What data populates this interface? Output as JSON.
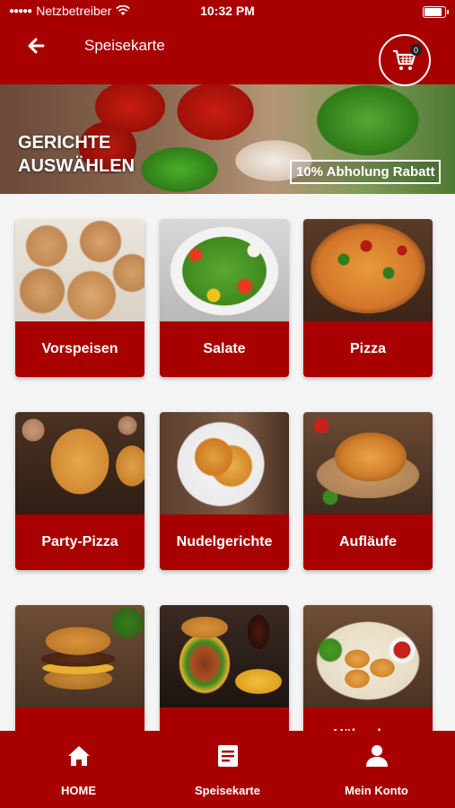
{
  "status_bar": {
    "carrier": "Netzbetreiber",
    "time": "10:32 PM",
    "battery_level": 0.9
  },
  "header": {
    "title": "Speisekarte",
    "cart_count": "0"
  },
  "hero": {
    "title_line1": "GERICHTE",
    "title_line2": "AUSWÄHLEN",
    "promo": "10% Abholung Rabatt"
  },
  "categories": [
    {
      "label": "Vorspeisen"
    },
    {
      "label": "Salate"
    },
    {
      "label": "Pizza"
    },
    {
      "label": "Party-Pizza"
    },
    {
      "label": "Nudelgerichte"
    },
    {
      "label": "Aufläufe"
    },
    {
      "label": ""
    },
    {
      "label": ""
    },
    {
      "label": "Hähnchen"
    }
  ],
  "bottom_nav": [
    {
      "label": "HOME",
      "icon": "home-icon"
    },
    {
      "label": "Speisekarte",
      "icon": "menu-icon"
    },
    {
      "label": "Mein Konto",
      "icon": "account-icon"
    }
  ],
  "colors": {
    "brand": "#a80000",
    "background": "#f4f4f4"
  }
}
